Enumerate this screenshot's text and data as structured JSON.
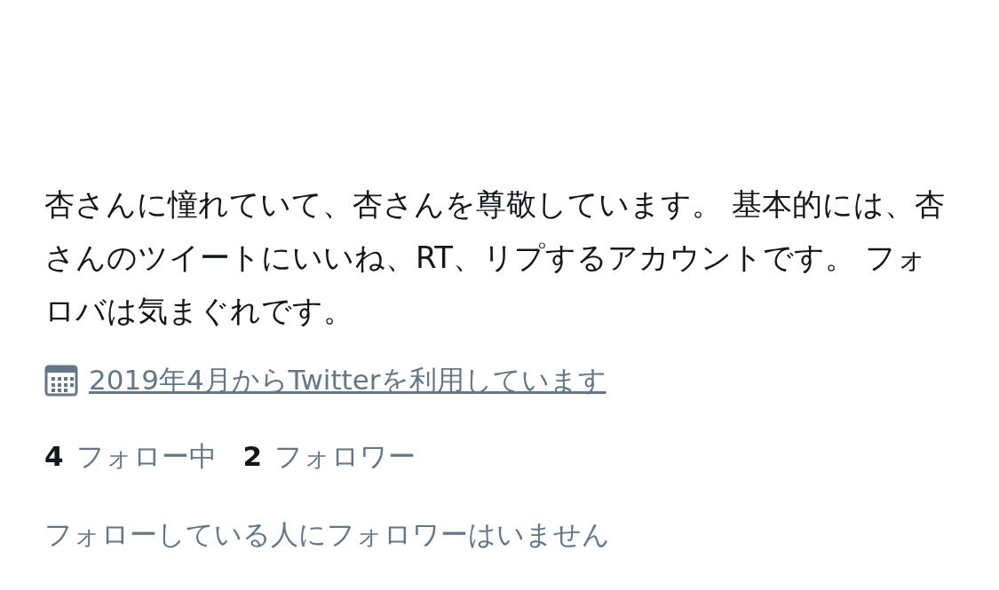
{
  "bio": "杏さんに憧れていて、杏さんを尊敬しています。 基本的には、杏さんのツイートにいいね、RT、リプするアカウントです。 フォロバは気まぐれです。",
  "joined": "2019年4月からTwitterを利用しています",
  "stats": [
    {
      "count": "4",
      "label": "フォロー中"
    },
    {
      "count": "2",
      "label": "フォロワー"
    }
  ],
  "followers_you_know": "フォローしている人にフォロワーはいません"
}
